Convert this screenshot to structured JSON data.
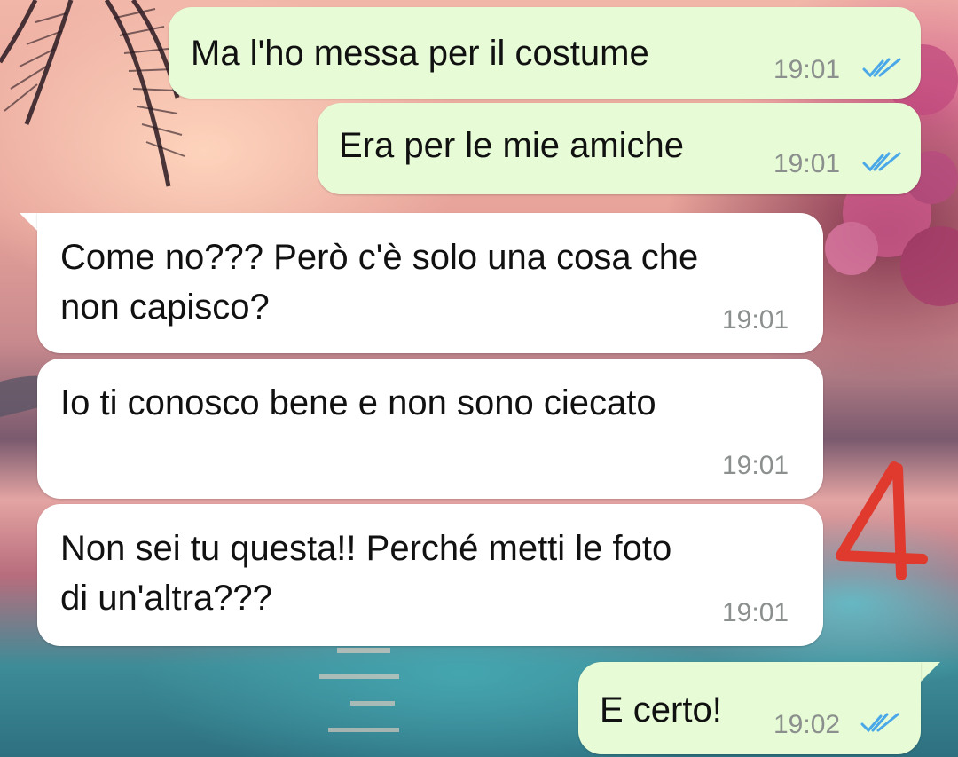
{
  "messages": [
    {
      "dir": "out",
      "text": "Ma l'ho messa per il costume",
      "time": "19:01",
      "status": "read"
    },
    {
      "dir": "out",
      "text": "Era per le mie amiche",
      "time": "19:01",
      "status": "read"
    },
    {
      "dir": "in",
      "line1": "Come no??? Però c'è solo una cosa che",
      "line2": "non capisco?",
      "time": "19:01"
    },
    {
      "dir": "in",
      "text": "Io ti conosco bene e non sono ciecato",
      "time": "19:01"
    },
    {
      "dir": "in",
      "line1": "Non sei tu questa!! Perché metti le foto",
      "line2": "di un'altra???",
      "time": "19:01"
    },
    {
      "dir": "out",
      "text": "E certo!",
      "time": "19:02",
      "status": "read"
    }
  ],
  "annotation": {
    "text": "4",
    "color": "#e03a2e"
  },
  "colors": {
    "outgoing_bubble": "#e7fbd6",
    "incoming_bubble": "#ffffff",
    "read_ticks": "#4aa8e8"
  }
}
